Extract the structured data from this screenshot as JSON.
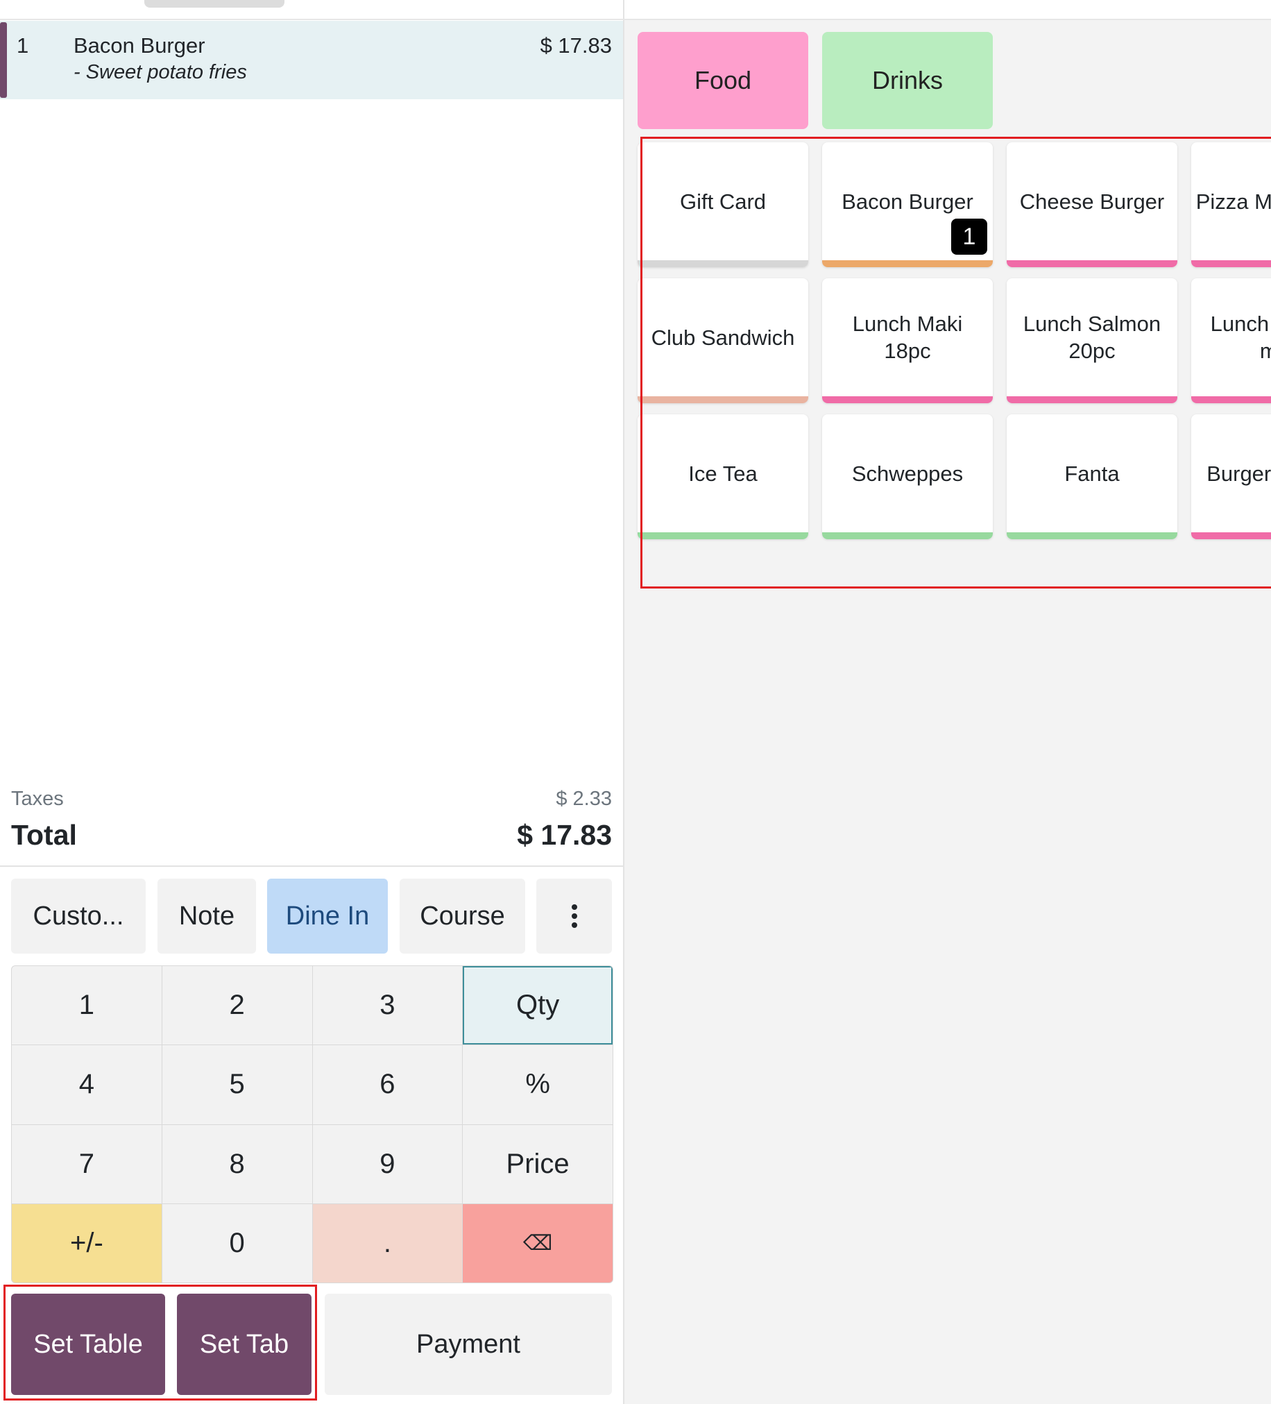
{
  "order": {
    "lines": [
      {
        "qty": "1",
        "name": "Bacon Burger",
        "note": "- Sweet potato fries",
        "price": "$ 17.83"
      }
    ],
    "taxes_label": "Taxes",
    "taxes_value": "$ 2.33",
    "total_label": "Total",
    "total_value": "$ 17.83"
  },
  "controls": {
    "customer": "Custo...",
    "note": "Note",
    "dine_in": "Dine In",
    "course": "Course"
  },
  "numpad": {
    "keys": [
      "1",
      "2",
      "3",
      "Qty",
      "4",
      "5",
      "6",
      "%",
      "7",
      "8",
      "9",
      "Price",
      "+/-",
      "0",
      ".",
      "⌫"
    ]
  },
  "actions": {
    "set_table": "Set Table",
    "set_tab": "Set Tab",
    "payment": "Payment"
  },
  "categories": [
    {
      "label": "Food",
      "color": "#fe9fcd"
    },
    {
      "label": "Drinks",
      "color": "#b9edbf"
    }
  ],
  "products": [
    {
      "name": "Gift Card",
      "bar_color": "#d6d6d6"
    },
    {
      "name": "Bacon Burger",
      "bar_color": "#eca869",
      "count": "1"
    },
    {
      "name": "Cheese Burger",
      "bar_color": "#f06ba7"
    },
    {
      "name": "Pizza Margherita",
      "bar_color": "#f06ba7"
    },
    {
      "name": "Club Sandwich",
      "bar_color": "#e9b3a0"
    },
    {
      "name": "Lunch Maki 18pc",
      "bar_color": "#f06ba7"
    },
    {
      "name": "Lunch Salmon 20pc",
      "bar_color": "#f06ba7"
    },
    {
      "name": "Lunch Temaki mix",
      "bar_color": "#f06ba7"
    },
    {
      "name": "Ice Tea",
      "bar_color": "#97d99e"
    },
    {
      "name": "Schweppes",
      "bar_color": "#97d99e"
    },
    {
      "name": "Fanta",
      "bar_color": "#97d99e"
    },
    {
      "name": "Burger Combo",
      "bar_color": "#f06ba7"
    }
  ],
  "colors": {
    "brand": "#71496a",
    "highlight": "#e11d21"
  }
}
